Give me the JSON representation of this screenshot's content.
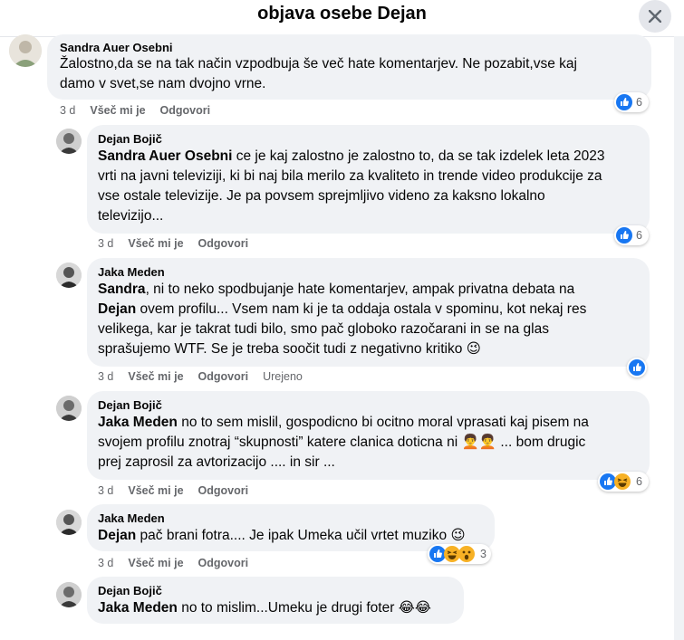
{
  "header": {
    "title": "objava osebe Dejan"
  },
  "colors": {
    "like": "#1877f2",
    "haha": "#f7b125",
    "bubble": "#f0f2f5",
    "meta": "#65676b"
  },
  "actions": {
    "like": "Všeč mi je",
    "reply": "Odgovori"
  },
  "comments": [
    {
      "author": "Sandra Auer Osebni",
      "text": [
        "Žalostno,da se na tak način vzpodbuja še več hate komentarjev. Ne pozabit,vse kaj",
        "damo v svet,se nam dvojno vrne."
      ],
      "time": "3 d",
      "reactions": [
        "like"
      ],
      "count": "6",
      "edited": ""
    },
    {
      "author": "Dejan Bojič",
      "mention": "Sandra Auer Osebni",
      "text": [
        " ce je kaj zalostno je zalostno to, da se tak izdelek leta 2023",
        "vrti na javni televiziji, ki bi naj bila merilo za kvaliteto in trende video produkcije za",
        "vse ostale televizije. Je pa povsem sprejmljivo videno za kaksno lokalno",
        "televizijo..."
      ],
      "time": "3 d",
      "reactions": [
        "like"
      ],
      "count": "6",
      "edited": ""
    },
    {
      "author": "Jaka Meden",
      "mention": "Sandra",
      "text": [
        ", ni to neko spodbujanje hate komentarjev, ampak privatna debata na",
        "Dejan|| ovem profilu... Vsem nam ki je ta oddaja ostala v spominu, kot nekaj res",
        "velikega, kar je takrat tudi bilo, smo pač globoko razočarani in se na glas",
        "sprašujemo WTF. Se je treba soočit tudi z negativno kritiko 😉"
      ],
      "time": "3 d",
      "reactions": [
        "like"
      ],
      "count": "",
      "edited": "Urejeno"
    },
    {
      "author": "Dejan Bojič",
      "mention": "Jaka Meden",
      "text": [
        " no to sem mislil, gospodicno bi ocitno moral vprasati kaj pisem na",
        "svojem profilu znotraj “skupnosti” katere clanica doticna ni 🧑‍🦱🧑‍🦱 ... bom drugic",
        "prej zaprosil za avtorizacijo .... in sir ..."
      ],
      "time": "3 d",
      "reactions": [
        "like",
        "haha"
      ],
      "count": "6",
      "edited": ""
    },
    {
      "author": "Jaka Meden",
      "mention": "Dejan",
      "text": [
        " pač brani fotra.... Je ipak Umeka učil vrtet muziko 😉"
      ],
      "time": "3 d",
      "reactions": [
        "like",
        "haha",
        "wow"
      ],
      "count": "3",
      "edited": ""
    },
    {
      "author": "Dejan Bojič",
      "mention": "Jaka Meden",
      "text": [
        " no to mislim...Umeku je drugi foter 😂😂"
      ],
      "time": "",
      "reactions": [],
      "count": "",
      "edited": ""
    }
  ]
}
